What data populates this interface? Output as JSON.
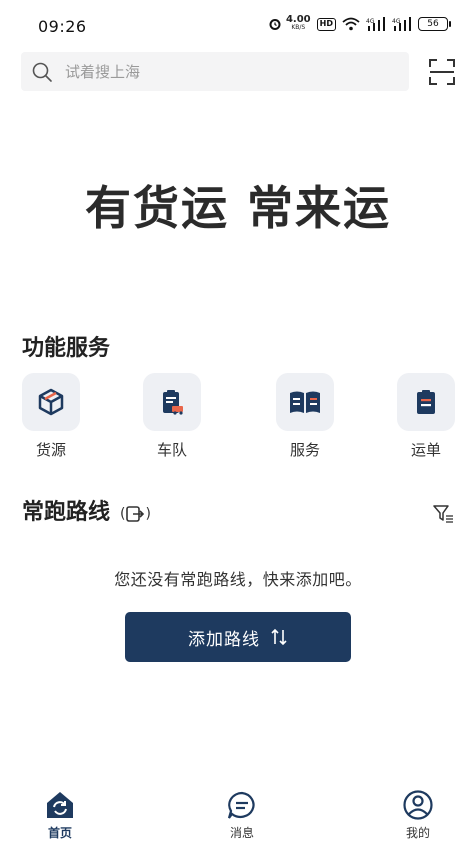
{
  "status_bar": {
    "time": "09:26",
    "net_speed": "4.00",
    "net_unit": "KB/S",
    "hd_badge": "HD",
    "signal1": "4G",
    "signal2": "4G",
    "battery": "56"
  },
  "search": {
    "placeholder": "试着搜上海"
  },
  "slogan": "有货运 常来运",
  "services": {
    "title": "功能服务",
    "items": [
      {
        "label": "货源",
        "icon": "cube-icon"
      },
      {
        "label": "车队",
        "icon": "clipboard-truck-icon"
      },
      {
        "label": "服务",
        "icon": "book-icon"
      },
      {
        "label": "运单",
        "icon": "clipboard-icon"
      }
    ]
  },
  "routes": {
    "title": "常跑路线",
    "switch_open": "(",
    "switch_close": ")",
    "empty_text": "您还没有常跑路线，快来添加吧。",
    "add_button_label": "添加路线"
  },
  "bottom_nav": {
    "items": [
      {
        "label": "首页",
        "icon": "home-icon",
        "active": true
      },
      {
        "label": "消息",
        "icon": "message-icon",
        "active": false
      },
      {
        "label": "我的",
        "icon": "profile-icon",
        "active": false
      }
    ]
  },
  "colors": {
    "primary": "#1e3a5f",
    "accent": "#e8664a",
    "tile_bg": "#eef0f4"
  }
}
